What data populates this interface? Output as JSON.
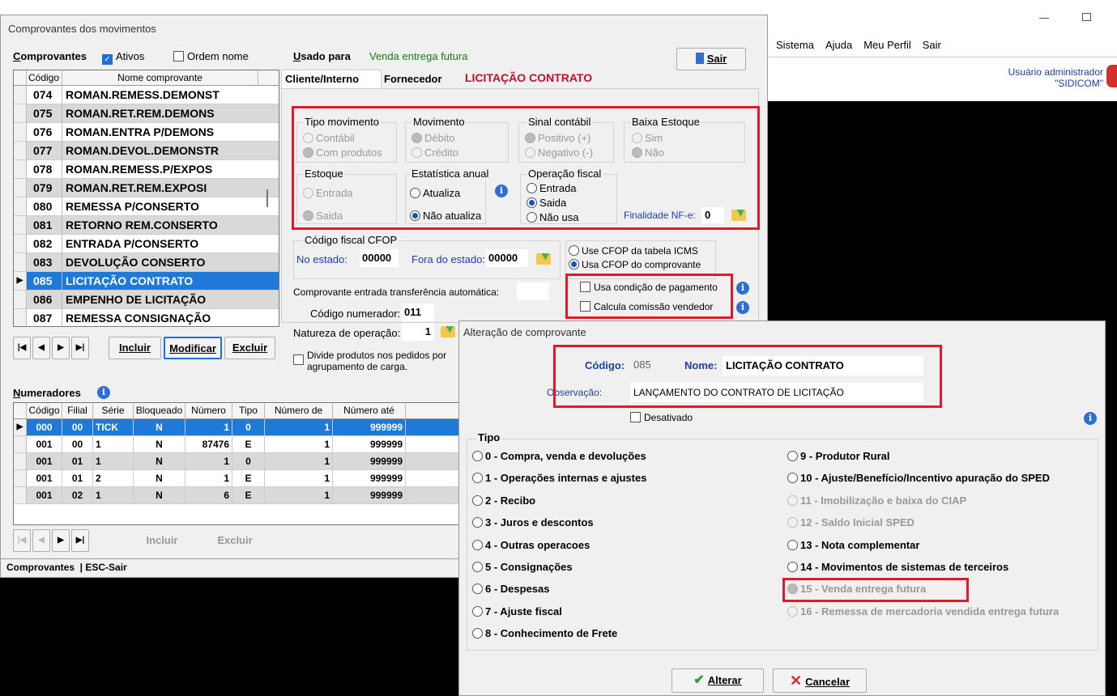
{
  "bg_window": {
    "menu": [
      "Sistema",
      "Ajuda",
      "Meu Perfil",
      "Sair"
    ],
    "user_line1": "Usuário administrador",
    "user_line2": "\"SIDICOM\""
  },
  "main_window": {
    "title": "Comprovantes dos movimentos",
    "comprovantes_label": "Comprovantes",
    "ativos_label": "Ativos",
    "ordem_nome_label": "Ordem nome",
    "list_headers": [
      "Código",
      "Nome comprovante"
    ],
    "list_rows": [
      {
        "code": "074",
        "name": "ROMAN.REMESS.DEMONST"
      },
      {
        "code": "075",
        "name": "ROMAN.RET.REM.DEMONS"
      },
      {
        "code": "076",
        "name": "ROMAN.ENTRA P/DEMONS"
      },
      {
        "code": "077",
        "name": "ROMAN.DEVOL.DEMONSTR"
      },
      {
        "code": "078",
        "name": "ROMAN.REMESS.P/EXPOS"
      },
      {
        "code": "079",
        "name": "ROMAN.RET.REM.EXPOSI"
      },
      {
        "code": "080",
        "name": "REMESSA P/CONSERTO"
      },
      {
        "code": "081",
        "name": "RETORNO REM.CONSERTO"
      },
      {
        "code": "082",
        "name": "ENTRADA P/CONSERTO"
      },
      {
        "code": "083",
        "name": "DEVOLUÇÃO CONSERTO"
      },
      {
        "code": "085",
        "name": "LICITAÇÃO CONTRATO"
      },
      {
        "code": "086",
        "name": "EMPENHO DE LICITAÇÃO"
      },
      {
        "code": "087",
        "name": "REMESSA CONSIGNAÇÃO"
      }
    ],
    "nav_buttons": {
      "incluir": "Incluir",
      "modificar": "Modificar",
      "excluir": "Excluir"
    },
    "usado_para_label": "Usado para",
    "usado_para_value": "Venda entrega futura",
    "sair": "Sair",
    "tabs": [
      "Cliente/Interno",
      "Fornecedor"
    ],
    "tab_title": "LICITAÇÃO CONTRATO",
    "tipo_movimento": {
      "title": "Tipo movimento",
      "opts": [
        "Contábil",
        "Com produtos"
      ]
    },
    "movimento": {
      "title": "Movimento",
      "opts": [
        "Débito",
        "Crédito"
      ]
    },
    "sinal": {
      "title": "Sinal contábil",
      "opts": [
        "Positivo (+)",
        "Negativo (-)"
      ]
    },
    "baixa": {
      "title": "Baixa Estoque",
      "opts": [
        "Sim",
        "Não"
      ]
    },
    "estoque": {
      "title": "Estoque",
      "opts": [
        "Entrada",
        "Saida"
      ]
    },
    "estatistica": {
      "title": "Estatística anual",
      "opts": [
        "Atualiza",
        "Não atualiza"
      ]
    },
    "operacao": {
      "title": "Operação fiscal",
      "opts": [
        "Entrada",
        "Saida",
        "Não usa"
      ]
    },
    "finalidade_label": "Finalidade NF-e:",
    "finalidade_value": "0",
    "cfop": {
      "title": "Código fiscal CFOP",
      "no_estado_label": "No estado:",
      "no_estado_value": "00000",
      "fora_label": "Fora do estado:",
      "fora_value": "00000",
      "opt1": "Use CFOP da tabela ICMS",
      "opt2": "Usa CFOP do comprovante"
    },
    "usa_condicao": "Usa condição de pagamento",
    "calcula_comissao": "Calcula comissão vendedor",
    "transf_label": "Comprovante entrada transferência automática:",
    "numerador_label": "Código numerador:",
    "numerador_value": "011",
    "natureza_label": "Natureza de operação:",
    "natureza_value": "1",
    "divide_line1": "Divide produtos nos pedidos por",
    "divide_line2": "agrupamento de carga.",
    "numeradores_label": "Numeradores",
    "num_headers": [
      "Código",
      "Filial",
      "Série",
      "Bloqueado",
      "Número",
      "Tipo",
      "Número de",
      "Número até"
    ],
    "num_rows": [
      [
        "000",
        "00",
        "TICK",
        "N",
        "1",
        "0",
        "1",
        "999999"
      ],
      [
        "001",
        "00",
        "1",
        "N",
        "87476",
        "E",
        "1",
        "999999"
      ],
      [
        "001",
        "01",
        "1",
        "N",
        "1",
        "0",
        "1",
        "999999"
      ],
      [
        "001",
        "01",
        "2",
        "N",
        "1",
        "E",
        "1",
        "999999"
      ],
      [
        "001",
        "02",
        "1",
        "N",
        "6",
        "E",
        "1",
        "999999"
      ]
    ],
    "num_incluir": "Incluir",
    "num_excluir": "Excluir",
    "status": "Comprovantes  | ESC-Sair"
  },
  "dialog": {
    "title": "Alteração de comprovante",
    "codigo_label": "Código:",
    "codigo_value": "085",
    "nome_label": "Nome:",
    "nome_value": "LICITAÇÃO CONTRATO",
    "obs_label": "Observação:",
    "obs_value": "LANÇAMENTO DO CONTRATO DE LICITAÇÃO",
    "desativado": "Desativado",
    "tipo_label": "Tipo",
    "left_opts": [
      "0 - Compra, venda e devoluções",
      "1 - Operações internas e ajustes",
      "2 - Recibo",
      "3 - Juros e descontos",
      "4 - Outras operacoes",
      "5 - Consignações",
      "6 - Despesas",
      "7 - Ajuste fiscal",
      "8 - Conhecimento de Frete"
    ],
    "right_opts": [
      "9 - Produtor Rural",
      "10 - Ajuste/Benefício/Incentivo apuração do SPED",
      "11 - Imobilização e baixa do CIAP",
      "12 - Saldo Inicial SPED",
      "13 - Nota complementar",
      "14 - Movimentos de sistemas de terceiros",
      "15 - Venda entrega futura",
      "16 - Remessa de mercadoria vendida entrega futura"
    ],
    "alterar": "Alterar",
    "cancelar": "Cancelar"
  }
}
